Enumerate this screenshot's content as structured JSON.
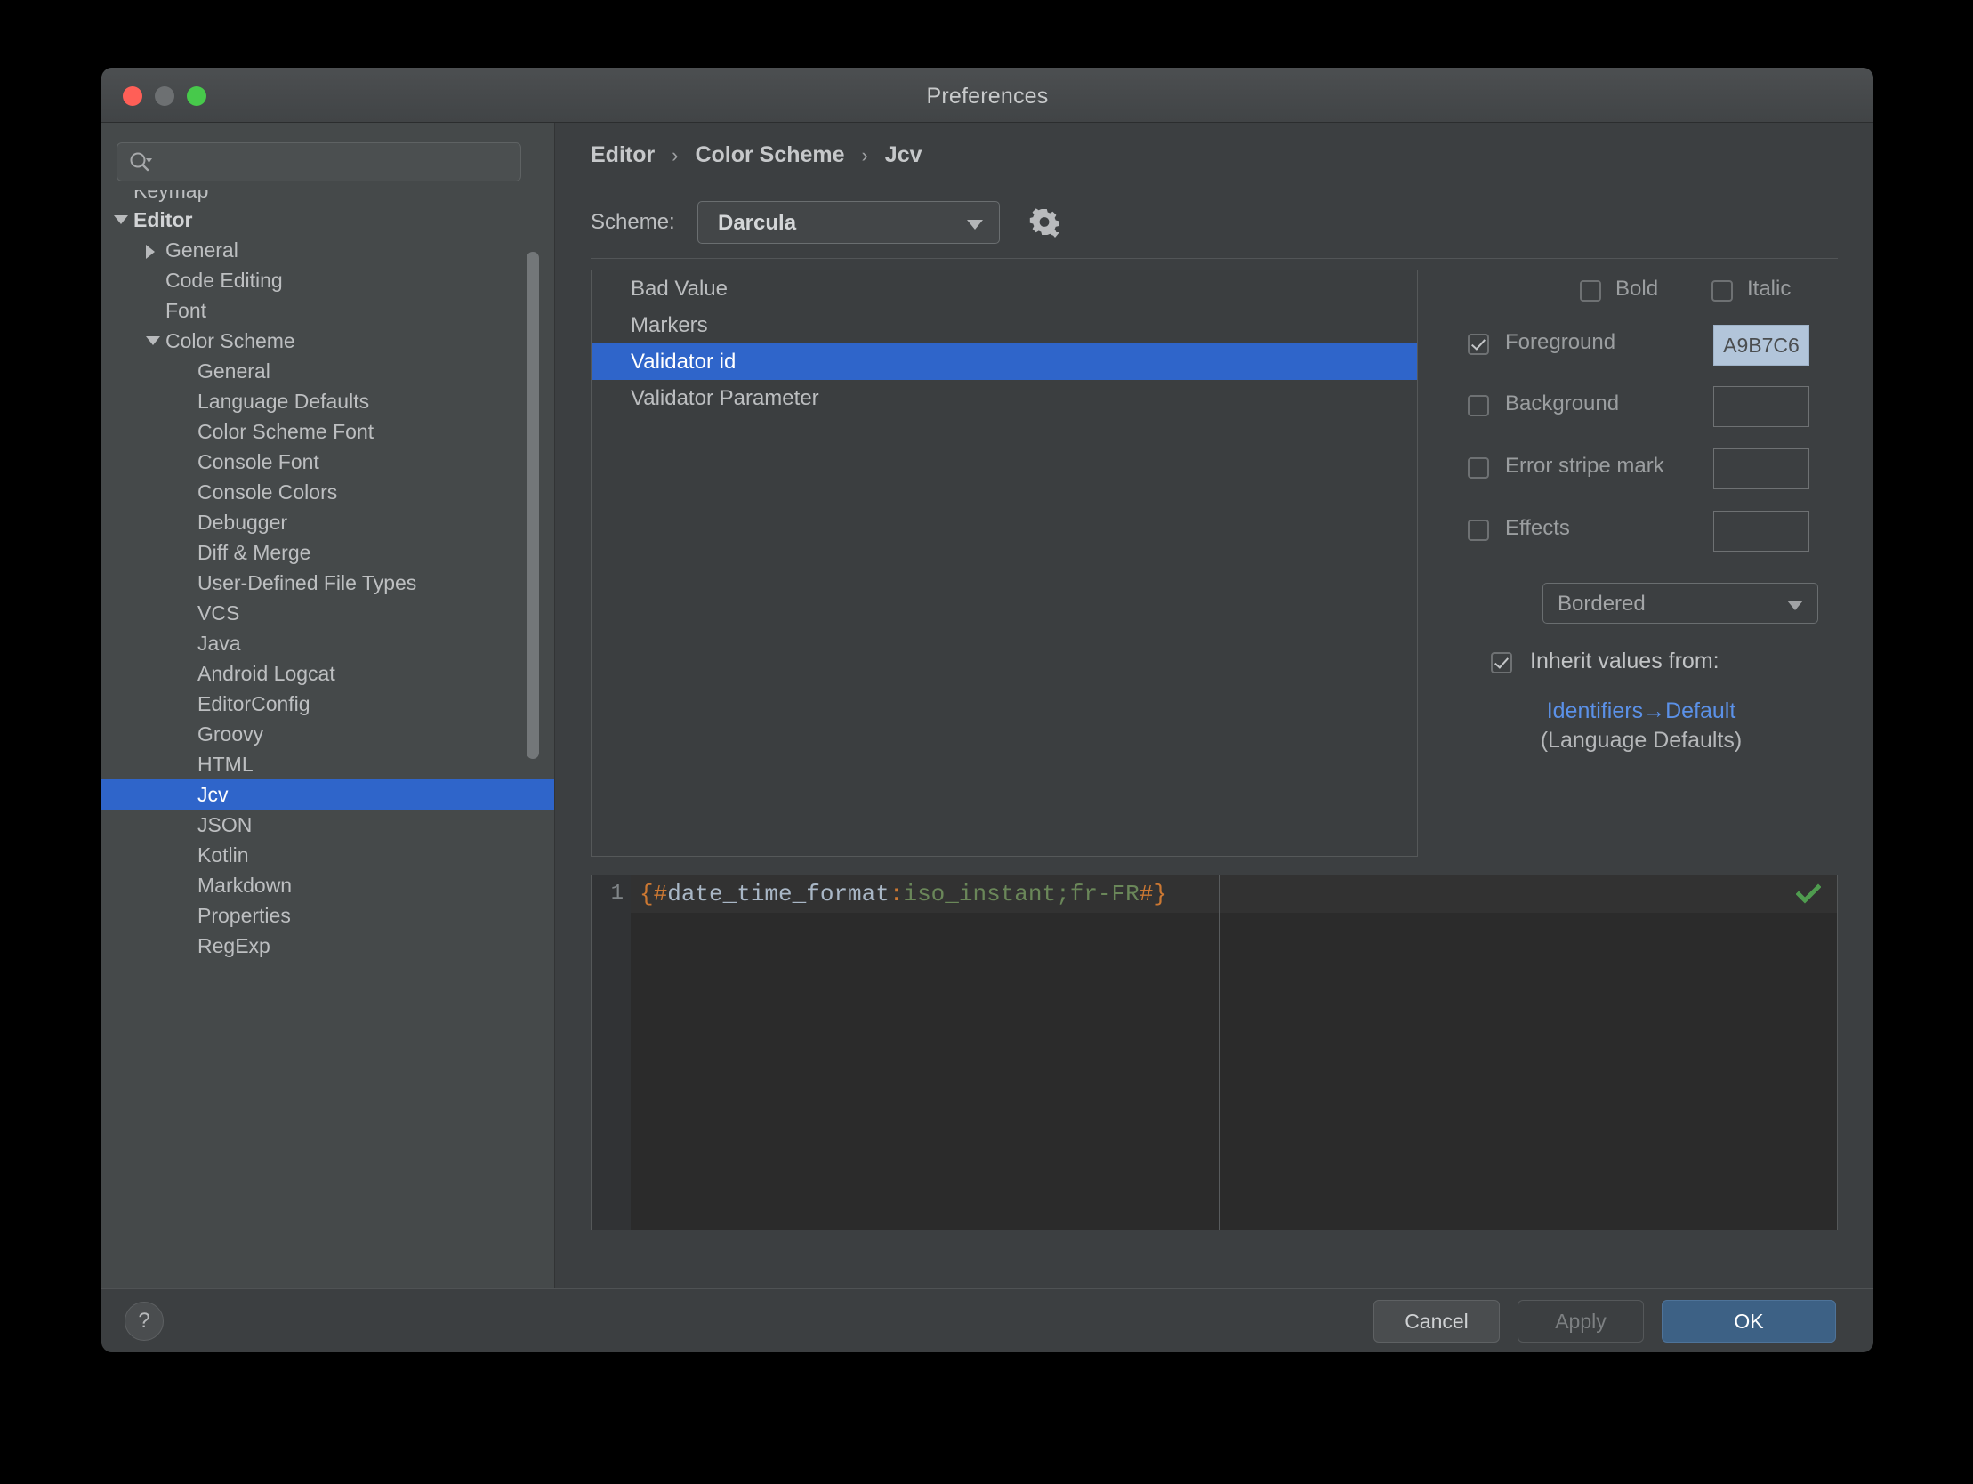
{
  "window": {
    "title": "Preferences",
    "traffic_lights": [
      "close",
      "minimize",
      "maximize"
    ]
  },
  "sidebar": {
    "search": {
      "value": "",
      "placeholder": ""
    },
    "items": [
      {
        "label": "Keymap",
        "indent": 0,
        "twisty": "none",
        "bold": false,
        "selected": false,
        "clipped": true
      },
      {
        "label": "Editor",
        "indent": 0,
        "twisty": "down",
        "bold": true,
        "selected": false
      },
      {
        "label": "General",
        "indent": 1,
        "twisty": "right",
        "bold": false,
        "selected": false
      },
      {
        "label": "Code Editing",
        "indent": 1,
        "twisty": "none",
        "bold": false,
        "selected": false
      },
      {
        "label": "Font",
        "indent": 1,
        "twisty": "none",
        "bold": false,
        "selected": false
      },
      {
        "label": "Color Scheme",
        "indent": 1,
        "twisty": "down",
        "bold": false,
        "selected": false
      },
      {
        "label": "General",
        "indent": 2,
        "twisty": "none",
        "bold": false,
        "selected": false
      },
      {
        "label": "Language Defaults",
        "indent": 2,
        "twisty": "none",
        "bold": false,
        "selected": false
      },
      {
        "label": "Color Scheme Font",
        "indent": 2,
        "twisty": "none",
        "bold": false,
        "selected": false
      },
      {
        "label": "Console Font",
        "indent": 2,
        "twisty": "none",
        "bold": false,
        "selected": false
      },
      {
        "label": "Console Colors",
        "indent": 2,
        "twisty": "none",
        "bold": false,
        "selected": false
      },
      {
        "label": "Debugger",
        "indent": 2,
        "twisty": "none",
        "bold": false,
        "selected": false
      },
      {
        "label": "Diff & Merge",
        "indent": 2,
        "twisty": "none",
        "bold": false,
        "selected": false
      },
      {
        "label": "User-Defined File Types",
        "indent": 2,
        "twisty": "none",
        "bold": false,
        "selected": false
      },
      {
        "label": "VCS",
        "indent": 2,
        "twisty": "none",
        "bold": false,
        "selected": false
      },
      {
        "label": "Java",
        "indent": 2,
        "twisty": "none",
        "bold": false,
        "selected": false
      },
      {
        "label": "Android Logcat",
        "indent": 2,
        "twisty": "none",
        "bold": false,
        "selected": false
      },
      {
        "label": "EditorConfig",
        "indent": 2,
        "twisty": "none",
        "bold": false,
        "selected": false
      },
      {
        "label": "Groovy",
        "indent": 2,
        "twisty": "none",
        "bold": false,
        "selected": false
      },
      {
        "label": "HTML",
        "indent": 2,
        "twisty": "none",
        "bold": false,
        "selected": false
      },
      {
        "label": "Jcv",
        "indent": 2,
        "twisty": "none",
        "bold": false,
        "selected": true
      },
      {
        "label": "JSON",
        "indent": 2,
        "twisty": "none",
        "bold": false,
        "selected": false
      },
      {
        "label": "Kotlin",
        "indent": 2,
        "twisty": "none",
        "bold": false,
        "selected": false
      },
      {
        "label": "Markdown",
        "indent": 2,
        "twisty": "none",
        "bold": false,
        "selected": false
      },
      {
        "label": "Properties",
        "indent": 2,
        "twisty": "none",
        "bold": false,
        "selected": false
      },
      {
        "label": "RegExp",
        "indent": 2,
        "twisty": "none",
        "bold": false,
        "selected": false
      }
    ]
  },
  "main": {
    "breadcrumb": {
      "part1": "Editor",
      "part2": "Color Scheme",
      "part3": "Jcv",
      "separator": "›"
    },
    "scheme": {
      "label": "Scheme:",
      "value": "Darcula",
      "gear_icon": "gear-icon"
    },
    "color_list": {
      "items": [
        {
          "label": "Bad Value",
          "selected": false
        },
        {
          "label": "Markers",
          "selected": false
        },
        {
          "label": "Validator id",
          "selected": true
        },
        {
          "label": "Validator Parameter",
          "selected": false
        }
      ]
    },
    "attributes": {
      "bold": {
        "label": "Bold",
        "checked": false
      },
      "italic": {
        "label": "Italic",
        "checked": false
      },
      "foreground": {
        "label": "Foreground",
        "checked": true,
        "color": "A9B7C6",
        "swatch_bg": "#b2c5da"
      },
      "background": {
        "label": "Background",
        "checked": false,
        "color": ""
      },
      "error_stripe_mark": {
        "label": "Error stripe mark",
        "checked": false,
        "color": ""
      },
      "effects": {
        "label": "Effects",
        "checked": false,
        "color": ""
      },
      "effect_type": {
        "value": "Bordered"
      },
      "inherit": {
        "label": "Inherit values from:",
        "checked": true,
        "link": "Identifiers→Default",
        "sublabel": "(Language Defaults)"
      }
    },
    "preview": {
      "line_number": "1",
      "tokens": [
        {
          "text": "{#",
          "type": "brace"
        },
        {
          "text": "date_time_format",
          "type": "name"
        },
        {
          "text": ":",
          "type": "brace"
        },
        {
          "text": "iso_instant",
          "type": "value"
        },
        {
          "text": ";fr-FR",
          "type": "value"
        },
        {
          "text": "#}",
          "type": "brace"
        }
      ],
      "full_text": "{#date_time_format:iso_instant;fr-FR#}",
      "status_icon": "checkmark-icon",
      "status_color": "#4f9c4f"
    }
  },
  "footer": {
    "help": "?",
    "cancel": "Cancel",
    "apply": "Apply",
    "ok": "OK"
  },
  "colors": {
    "accent_blue": "#2f65ca",
    "link_blue": "#5b91e8",
    "window_bg": "#3c3f41",
    "sidebar_bg": "#45494a",
    "editor_bg": "#2b2b2b",
    "token_orange": "#cc7832",
    "token_gray": "#a9b7c6",
    "token_green": "#6a8759"
  }
}
